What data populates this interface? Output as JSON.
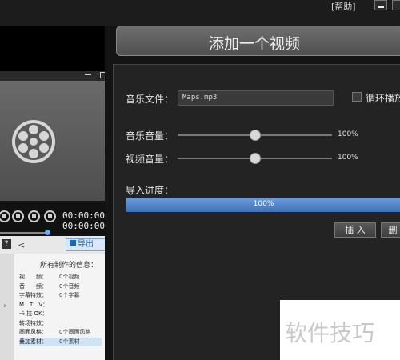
{
  "top_bar": {
    "help_link": "[帮助]"
  },
  "left_preview": {
    "timecode_current": "00:00:00",
    "timecode_total": "00:00:00",
    "export_label": "导出",
    "info_title": "所有制作的信息：",
    "info_rows": [
      {
        "label": "视　　频：",
        "value": "0个视频"
      },
      {
        "label": "音　　频：",
        "value": "0个音频"
      },
      {
        "label": "字幕特效：",
        "value": "0个字幕"
      },
      {
        "label": "M　T　V：",
        "value": ""
      },
      {
        "label": "卡 拉 OK：",
        "value": ""
      },
      {
        "label": "转场特效：",
        "value": ""
      },
      {
        "label": "画面风格：",
        "value": "0个画面风格"
      },
      {
        "label": "叠加素材：",
        "value": "0个素材"
      }
    ]
  },
  "header": {
    "title": "添加一个视频"
  },
  "form": {
    "music_file_label": "音乐文件：",
    "music_file_value": "Maps.mp3",
    "loop_label": "循环播放",
    "music_volume_label": "音乐音量：",
    "music_volume_value": "100%",
    "music_volume_level": 0.5,
    "video_volume_label": "视频音量：",
    "video_volume_value": "100%",
    "video_volume_level": 0.5,
    "import_progress_label": "导入进度：",
    "import_progress_value": "100%",
    "import_progress_level": 1.0,
    "insert_button": "插 入",
    "delete_button": "删"
  },
  "watermark": {
    "text": "软件技巧"
  }
}
